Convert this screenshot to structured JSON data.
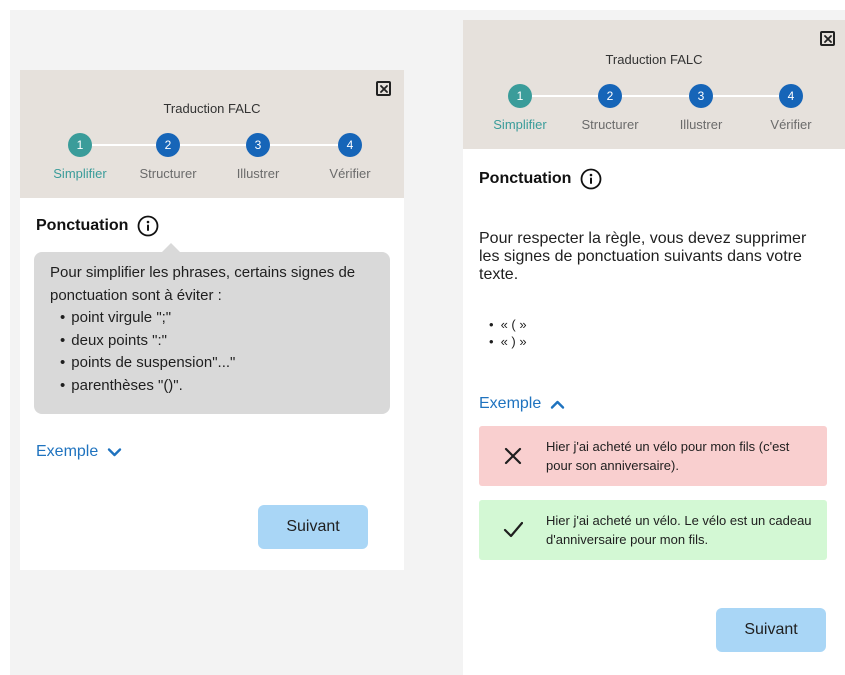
{
  "colors": {
    "header_bg": "#e6e1dc",
    "step_active": "#3a9c9a",
    "step_default": "#1665b8",
    "link": "#1f73bf",
    "button_bg": "#a9d6f6",
    "tooltip_bg": "#d9d9d9",
    "bad_bg": "#f9cfcf",
    "good_bg": "#d3f8d4"
  },
  "left_panel": {
    "header_title": "Traduction FALC",
    "close_icon": "close-icon",
    "steps": [
      {
        "number": "1",
        "label": "Simplifier",
        "active": true
      },
      {
        "number": "2",
        "label": "Structurer",
        "active": false
      },
      {
        "number": "3",
        "label": "Illustrer",
        "active": false
      },
      {
        "number": "4",
        "label": "Vérifier",
        "active": false
      }
    ],
    "section_title": "Ponctuation",
    "info_icon": "info-icon",
    "tooltip": {
      "intro": "Pour simplifier les phrases, certains signes de ponctuation sont à éviter :",
      "items": [
        "point virgule \";\"",
        "deux points \":\"",
        "points de suspension\"...\"",
        "parenthèses \"()\"."
      ]
    },
    "example_label": "Exemple",
    "example_state": "collapsed",
    "next_label": "Suivant"
  },
  "right_panel": {
    "header_title": "Traduction FALC",
    "close_icon": "close-icon",
    "steps": [
      {
        "number": "1",
        "label": "Simplifier",
        "active": true
      },
      {
        "number": "2",
        "label": "Structurer",
        "active": false
      },
      {
        "number": "3",
        "label": "Illustrer",
        "active": false
      },
      {
        "number": "4",
        "label": "Vérifier",
        "active": false
      }
    ],
    "section_title": "Ponctuation",
    "info_icon": "info-icon",
    "body_text": "Pour respecter la règle, vous devez supprimer les signes de ponctuation suivants dans votre texte.",
    "bullets": [
      "« ( »",
      "« ) »"
    ],
    "example_label": "Exemple",
    "example_state": "expanded",
    "bad_example": "Hier j'ai acheté un vélo pour mon fils (c'est pour son anniversaire).",
    "good_example": "Hier j'ai acheté un vélo. Le vélo est un cadeau d'anniversaire pour mon fils.",
    "next_label": "Suivant"
  }
}
